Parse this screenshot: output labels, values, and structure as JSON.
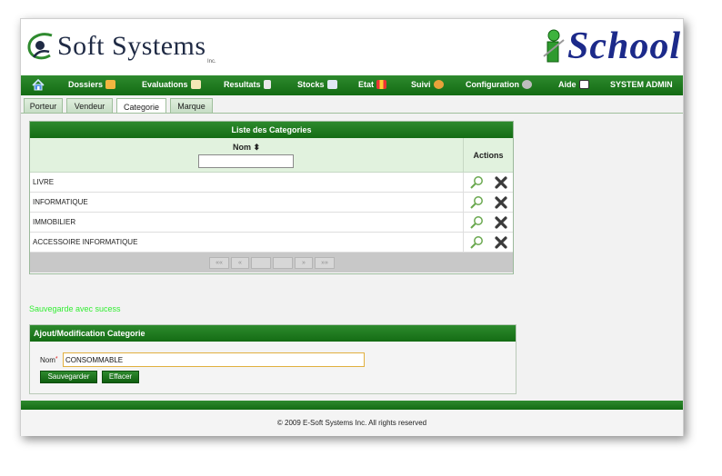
{
  "header": {
    "company_name": "Soft Systems",
    "company_suffix": "Inc.",
    "product_name": "School",
    "product_letter": "i"
  },
  "menu": [
    {
      "label": "",
      "icon": "home-icon",
      "name": "menu-home"
    },
    {
      "label": "Dossiers",
      "icon": "folder-icon",
      "name": "menu-dossiers"
    },
    {
      "label": "Evaluations",
      "icon": "edit-icon",
      "name": "menu-evaluations"
    },
    {
      "label": "Resultats",
      "icon": "document-icon",
      "name": "menu-resultats"
    },
    {
      "label": "Stocks",
      "icon": "mail-icon",
      "name": "menu-stocks"
    },
    {
      "label": "Etat",
      "icon": "bar-chart-icon",
      "name": "menu-etat"
    },
    {
      "label": "Suivi",
      "icon": "user-icon",
      "name": "menu-suivi"
    },
    {
      "label": "Configuration",
      "icon": "gear-icon",
      "name": "menu-configuration"
    },
    {
      "label": "Aide",
      "icon": "help-icon",
      "name": "menu-aide"
    },
    {
      "label": "SYSTEM ADMIN",
      "icon": "",
      "name": "menu-system-admin"
    }
  ],
  "tabs": [
    {
      "label": "Porteur"
    },
    {
      "label": "Vendeur"
    },
    {
      "label": "Categorie",
      "active": true
    },
    {
      "label": "Marque"
    }
  ],
  "list": {
    "title": "Liste des Categories",
    "col_nom": "Nom",
    "col_actions": "Actions",
    "filter_value": "",
    "rows": [
      "LIVRE",
      "INFORMATIQUE",
      "IMMOBILIER",
      "ACCESSOIRE INFORMATIQUE"
    ],
    "row_actions": [
      "search-icon",
      "delete-icon"
    ],
    "pager": [
      "««",
      "«",
      "",
      "",
      "»",
      "»»"
    ]
  },
  "message": "Sauvegarde avec sucess",
  "form": {
    "title": "Ajout/Modification Categorie",
    "nom_label": "Nom",
    "required_mark": "*",
    "nom_value": "CONSOMMABLE",
    "save_label": "Sauvegarder",
    "clear_label": "Effacer"
  },
  "footer": {
    "copyright": "© 2009 E-Soft Systems Inc. All rights reserved"
  },
  "colors": {
    "menu_green": "#1f7a1f",
    "header_green": "#2d8a2d",
    "light_green": "#e1f2de",
    "success_text": "#33ee33",
    "logo_blue": "#1c2a8a"
  }
}
